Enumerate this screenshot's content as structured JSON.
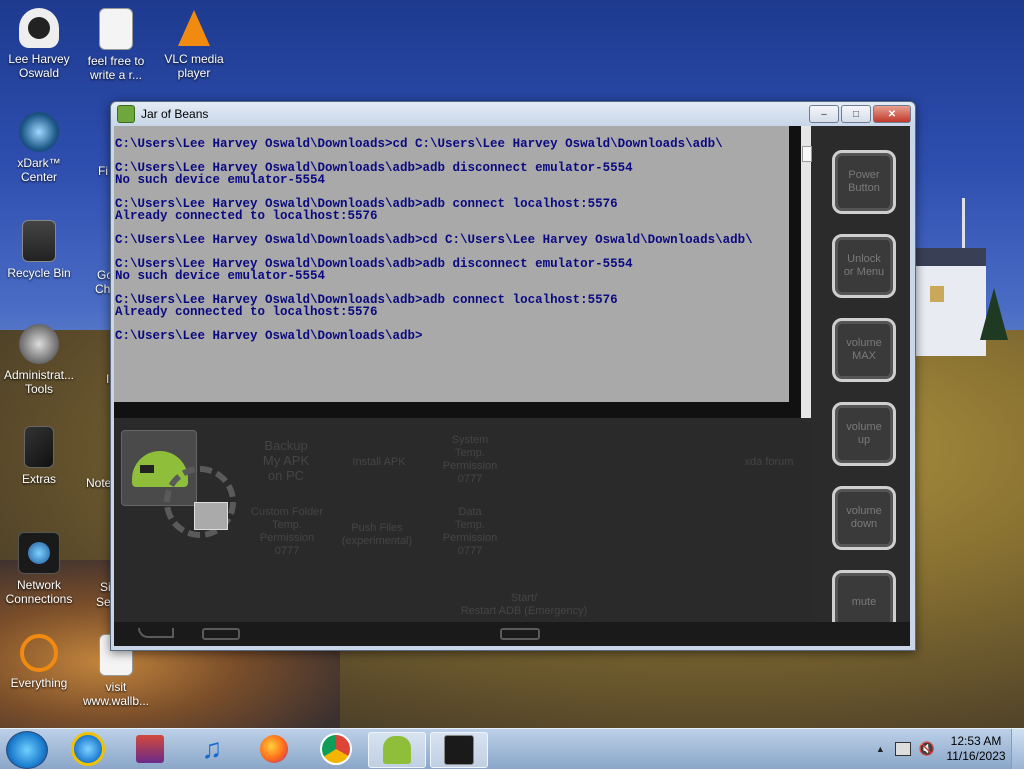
{
  "desktop": {
    "icons": [
      {
        "label": "Lee Harvey\nOswald"
      },
      {
        "label": "feel free to\nwrite a r..."
      },
      {
        "label": "VLC media\nplayer"
      },
      {
        "label": "xDark™\nCenter"
      },
      {
        "label": "Recycle Bin"
      },
      {
        "label": "Administrat...\nTools"
      },
      {
        "label": "Extras"
      },
      {
        "label": "Network\nConnections"
      },
      {
        "label": "Everything"
      },
      {
        "label": "visit\nwww.wallb..."
      }
    ],
    "partial_labels": [
      "Fi",
      "Go",
      "Ch",
      "I",
      "Note",
      "Si",
      "Se"
    ]
  },
  "window": {
    "title": "Jar of Beans",
    "terminal": {
      "lines": "C:\\Users\\Lee Harvey Oswald\\Downloads>cd C:\\Users\\Lee Harvey Oswald\\Downloads\\adb\\\n\nC:\\Users\\Lee Harvey Oswald\\Downloads\\adb>adb disconnect emulator-5554\nNo such device emulator-5554\n\nC:\\Users\\Lee Harvey Oswald\\Downloads\\adb>adb connect localhost:5576\nAlready connected to localhost:5576\n\nC:\\Users\\Lee Harvey Oswald\\Downloads\\adb>cd C:\\Users\\Lee Harvey Oswald\\Downloads\\adb\\\n\nC:\\Users\\Lee Harvey Oswald\\Downloads\\adb>adb disconnect emulator-5554\nNo such device emulator-5554\n\nC:\\Users\\Lee Harvey Oswald\\Downloads\\adb>adb connect localhost:5576\nAlready connected to localhost:5576\n\nC:\\Users\\Lee Harvey Oswald\\Downloads\\adb>"
    },
    "side_buttons": {
      "power": "Power\nButton",
      "unlock": "Unlock\nor Menu",
      "vol_max": "volume\nMAX",
      "vol_up": "volume\nup",
      "vol_down": "volume\ndown",
      "mute": "mute"
    },
    "options": {
      "backup": "Backup\nMy APK\non PC",
      "install": "Install APK",
      "system": "System\nTemp.\nPermission\n0777",
      "xda": "xda forum",
      "custom": "Custom Folder\nTemp.\nPermission\n0777",
      "push": "Push Files\n(experimental)",
      "data": "Data\nTemp.\nPermission\n0777",
      "restart": "Start/\nRestart ADB (Emergency)"
    }
  },
  "taskbar": {
    "time": "12:53 AM",
    "date": "11/16/2023"
  },
  "colors": {
    "terminal_bg": "#a9a9a9",
    "terminal_text": "#0a0a80",
    "android_green": "#8fbf3a"
  }
}
